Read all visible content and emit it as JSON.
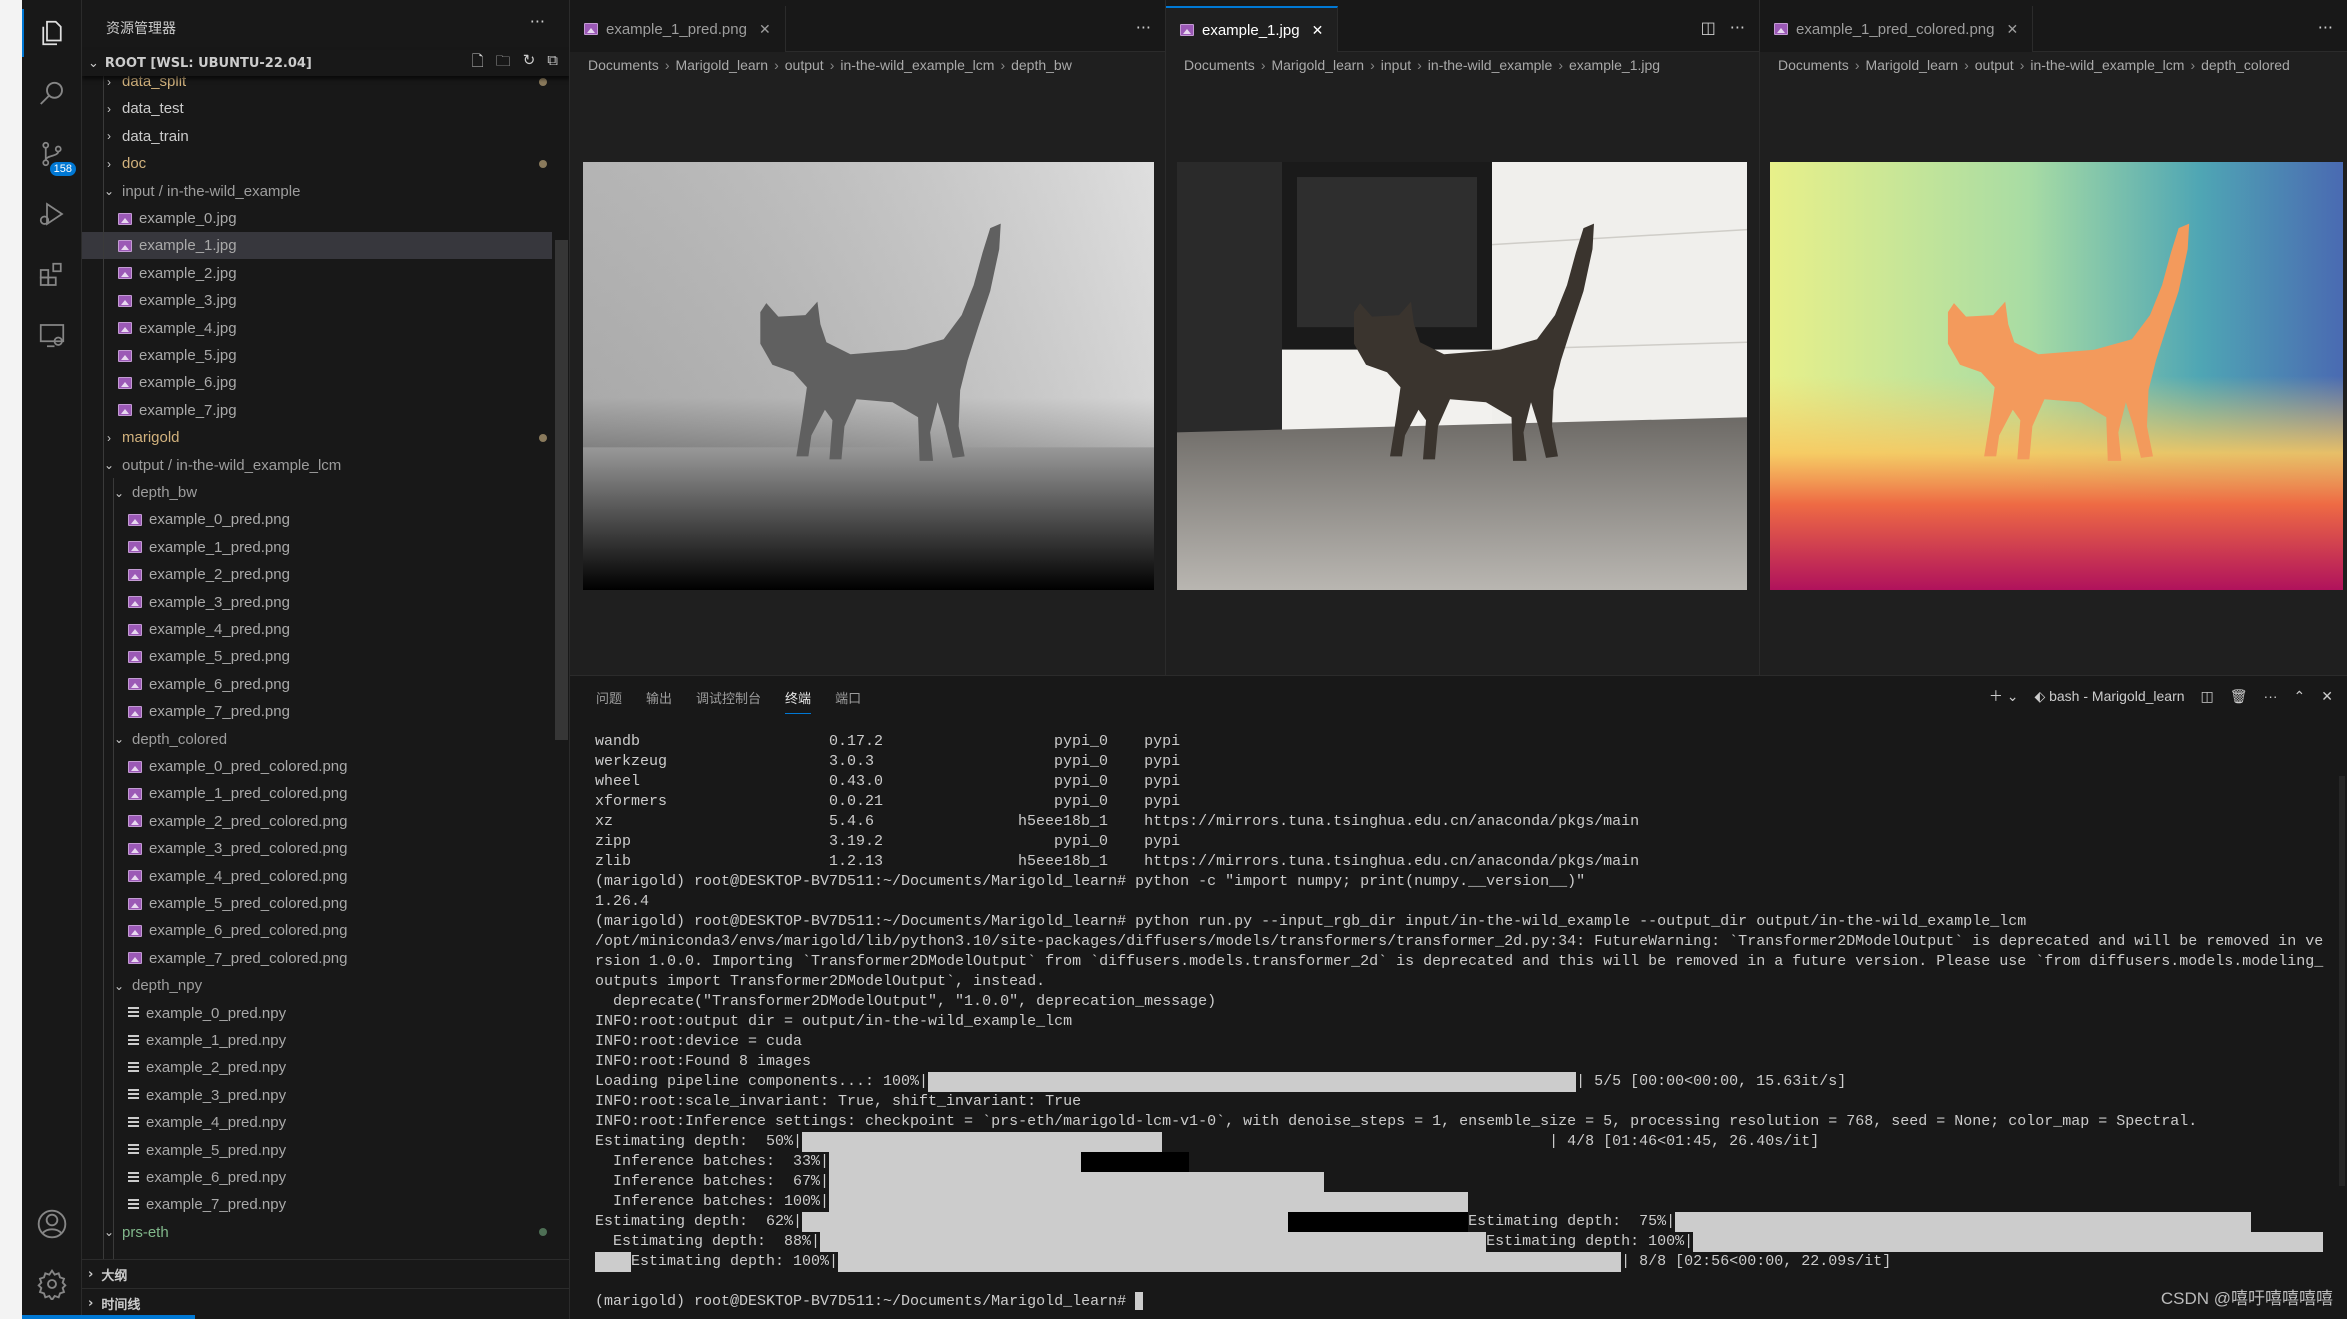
{
  "sidebar": {
    "title": "资源管理器",
    "root": "ROOT [WSL: UBUNTU-22.04]",
    "tree": [
      {
        "label": "data_split",
        "type": "folder",
        "depth": 0,
        "open": false,
        "color": "#d2b27d",
        "dot": "#8a7a5c"
      },
      {
        "label": "data_test",
        "type": "folder",
        "depth": 0,
        "open": false
      },
      {
        "label": "data_train",
        "type": "folder",
        "depth": 0,
        "open": false
      },
      {
        "label": "doc",
        "type": "folder",
        "depth": 0,
        "open": false,
        "color": "#d2b27d",
        "dot": "#8a7a5c"
      },
      {
        "label": "input / in-the-wild_example",
        "type": "folder",
        "depth": 0,
        "open": true,
        "color": "#9d9d9d"
      },
      {
        "label": "example_0.jpg",
        "type": "img",
        "depth": 1
      },
      {
        "label": "example_1.jpg",
        "type": "img",
        "depth": 1,
        "selected": true
      },
      {
        "label": "example_2.jpg",
        "type": "img",
        "depth": 1
      },
      {
        "label": "example_3.jpg",
        "type": "img",
        "depth": 1
      },
      {
        "label": "example_4.jpg",
        "type": "img",
        "depth": 1
      },
      {
        "label": "example_5.jpg",
        "type": "img",
        "depth": 1
      },
      {
        "label": "example_6.jpg",
        "type": "img",
        "depth": 1
      },
      {
        "label": "example_7.jpg",
        "type": "img",
        "depth": 1
      },
      {
        "label": "marigold",
        "type": "folder",
        "depth": 0,
        "open": false,
        "color": "#d2b27d",
        "dot": "#8a7a5c"
      },
      {
        "label": "output / in-the-wild_example_lcm",
        "type": "folder",
        "depth": 0,
        "open": true,
        "color": "#9d9d9d"
      },
      {
        "label": "depth_bw",
        "type": "folder",
        "depth": 1,
        "open": true,
        "color": "#9d9d9d"
      },
      {
        "label": "example_0_pred.png",
        "type": "img",
        "depth": 2
      },
      {
        "label": "example_1_pred.png",
        "type": "img",
        "depth": 2
      },
      {
        "label": "example_2_pred.png",
        "type": "img",
        "depth": 2
      },
      {
        "label": "example_3_pred.png",
        "type": "img",
        "depth": 2
      },
      {
        "label": "example_4_pred.png",
        "type": "img",
        "depth": 2
      },
      {
        "label": "example_5_pred.png",
        "type": "img",
        "depth": 2
      },
      {
        "label": "example_6_pred.png",
        "type": "img",
        "depth": 2
      },
      {
        "label": "example_7_pred.png",
        "type": "img",
        "depth": 2
      },
      {
        "label": "depth_colored",
        "type": "folder",
        "depth": 1,
        "open": true,
        "color": "#9d9d9d"
      },
      {
        "label": "example_0_pred_colored.png",
        "type": "img",
        "depth": 2
      },
      {
        "label": "example_1_pred_colored.png",
        "type": "img",
        "depth": 2
      },
      {
        "label": "example_2_pred_colored.png",
        "type": "img",
        "depth": 2
      },
      {
        "label": "example_3_pred_colored.png",
        "type": "img",
        "depth": 2
      },
      {
        "label": "example_4_pred_colored.png",
        "type": "img",
        "depth": 2
      },
      {
        "label": "example_5_pred_colored.png",
        "type": "img",
        "depth": 2
      },
      {
        "label": "example_6_pred_colored.png",
        "type": "img",
        "depth": 2
      },
      {
        "label": "example_7_pred_colored.png",
        "type": "img",
        "depth": 2
      },
      {
        "label": "depth_npy",
        "type": "folder",
        "depth": 1,
        "open": true,
        "color": "#9d9d9d"
      },
      {
        "label": "example_0_pred.npy",
        "type": "npy",
        "depth": 2
      },
      {
        "label": "example_1_pred.npy",
        "type": "npy",
        "depth": 2
      },
      {
        "label": "example_2_pred.npy",
        "type": "npy",
        "depth": 2
      },
      {
        "label": "example_3_pred.npy",
        "type": "npy",
        "depth": 2
      },
      {
        "label": "example_4_pred.npy",
        "type": "npy",
        "depth": 2
      },
      {
        "label": "example_5_pred.npy",
        "type": "npy",
        "depth": 2
      },
      {
        "label": "example_6_pred.npy",
        "type": "npy",
        "depth": 2
      },
      {
        "label": "example_7_pred.npy",
        "type": "npy",
        "depth": 2
      },
      {
        "label": "prs-eth",
        "type": "folder",
        "depth": 0,
        "open": true,
        "color": "#81b88b",
        "dot": "#4e6f55"
      }
    ],
    "outline": "大纲",
    "timeline": "时间线"
  },
  "activity": {
    "scm_badge": "158"
  },
  "editors": [
    {
      "tab": "example_1_pred.png",
      "active": false,
      "crumbs": [
        "Documents",
        "Marigold_learn",
        "output",
        "in-the-wild_example_lcm",
        "depth_bw"
      ]
    },
    {
      "tab": "example_1.jpg",
      "active": true,
      "crumbs": [
        "Documents",
        "Marigold_learn",
        "input",
        "in-the-wild_example",
        "example_1.jpg"
      ]
    },
    {
      "tab": "example_1_pred_colored.png",
      "active": false,
      "crumbs": [
        "Documents",
        "Marigold_learn",
        "output",
        "in-the-wild_example_lcm",
        "depth_colored"
      ]
    }
  ],
  "panel": {
    "tabs": [
      "问题",
      "输出",
      "调试控制台",
      "终端",
      "端口"
    ],
    "active_tab": "终端",
    "terminal_name": "bash - Marigold_learn"
  },
  "terminal": {
    "packages": [
      {
        "name": "wandb",
        "version": "0.17.2",
        "build": "pypi_0",
        "channel": "pypi"
      },
      {
        "name": "werkzeug",
        "version": "3.0.3",
        "build": "pypi_0",
        "channel": "pypi"
      },
      {
        "name": "wheel",
        "version": "0.43.0",
        "build": "pypi_0",
        "channel": "pypi"
      },
      {
        "name": "xformers",
        "version": "0.0.21",
        "build": "pypi_0",
        "channel": "pypi"
      },
      {
        "name": "xz",
        "version": "5.4.6",
        "build": "h5eee18b_1",
        "channel": "https://mirrors.tuna.tsinghua.edu.cn/anaconda/pkgs/main"
      },
      {
        "name": "zipp",
        "version": "3.19.2",
        "build": "pypi_0",
        "channel": "pypi"
      },
      {
        "name": "zlib",
        "version": "1.2.13",
        "build": "h5eee18b_1",
        "channel": "https://mirrors.tuna.tsinghua.edu.cn/anaconda/pkgs/main"
      }
    ],
    "lines": {
      "cmd1": "(marigold) root@DESKTOP-BV7D511:~/Documents/Marigold_learn# python -c \"import numpy; print(numpy.__version__)\"",
      "out1": "1.26.4",
      "cmd2": "(marigold) root@DESKTOP-BV7D511:~/Documents/Marigold_learn# python run.py --input_rgb_dir input/in-the-wild_example --output_dir output/in-the-wild_example_lcm",
      "warn1": "/opt/miniconda3/envs/marigold/lib/python3.10/site-packages/diffusers/models/transformers/transformer_2d.py:34: FutureWarning: `Transformer2DModelOutput` is deprecated and will be removed in ve",
      "warn2": "rsion 1.0.0. Importing `Transformer2DModelOutput` from `diffusers.models.transformer_2d` is deprecated and this will be removed in a future version. Please use `from diffusers.models.modeling_",
      "warn3": "outputs import Transformer2DModelOutput`, instead.",
      "warn4": "  deprecate(\"Transformer2DModelOutput\", \"1.0.0\", deprecation_message)",
      "info1": "INFO:root:output dir = output/in-the-wild_example_lcm",
      "info2": "INFO:root:device = cuda",
      "info3": "INFO:root:Found 8 images",
      "load_prefix": "Loading pipeline components...: 100%|",
      "load_suffix": "| 5/5 [00:00<00:00, 15.63it/s]",
      "info4": "INFO:root:scale_invariant: True, shift_invariant: True",
      "info5": "INFO:root:Inference settings: checkpoint = `prs-eth/marigold-lcm-v1-0`, with denoise_steps = 1, ensemble_size = 5, processing resolution = 768, seed = None; color_map = Spectral.",
      "est50": "Estimating depth:  50%|",
      "est50_suffix": "| 4/8 [01:46<01:45, 26.40s/it]",
      "ib33": "  Inference batches:  33%|",
      "ib67": "  Inference batches:  67%|",
      "ib100": "  Inference batches: 100%|",
      "est62": "Estimating depth:  62%|",
      "est75": "Estimating depth:  75%|",
      "est88": "  Estimating depth:  88%|",
      "est100a": "Estimating depth: 100%|",
      "est100b": "Estimating depth: 100%|",
      "est100_suffix": "| 8/8 [02:56<00:00, 22.09s/it]",
      "prompt": "(marigold) root@DESKTOP-BV7D511:~/Documents/Marigold_learn# "
    }
  },
  "watermark": "CSDN @嘻吁嘻嘻嘻嘻",
  "colors": {
    "accent": "#0078d4",
    "bg": "#181818",
    "editor_bg": "#1f1f1f",
    "modified_folder": "#d2b27d",
    "untracked_folder": "#81b88b"
  }
}
